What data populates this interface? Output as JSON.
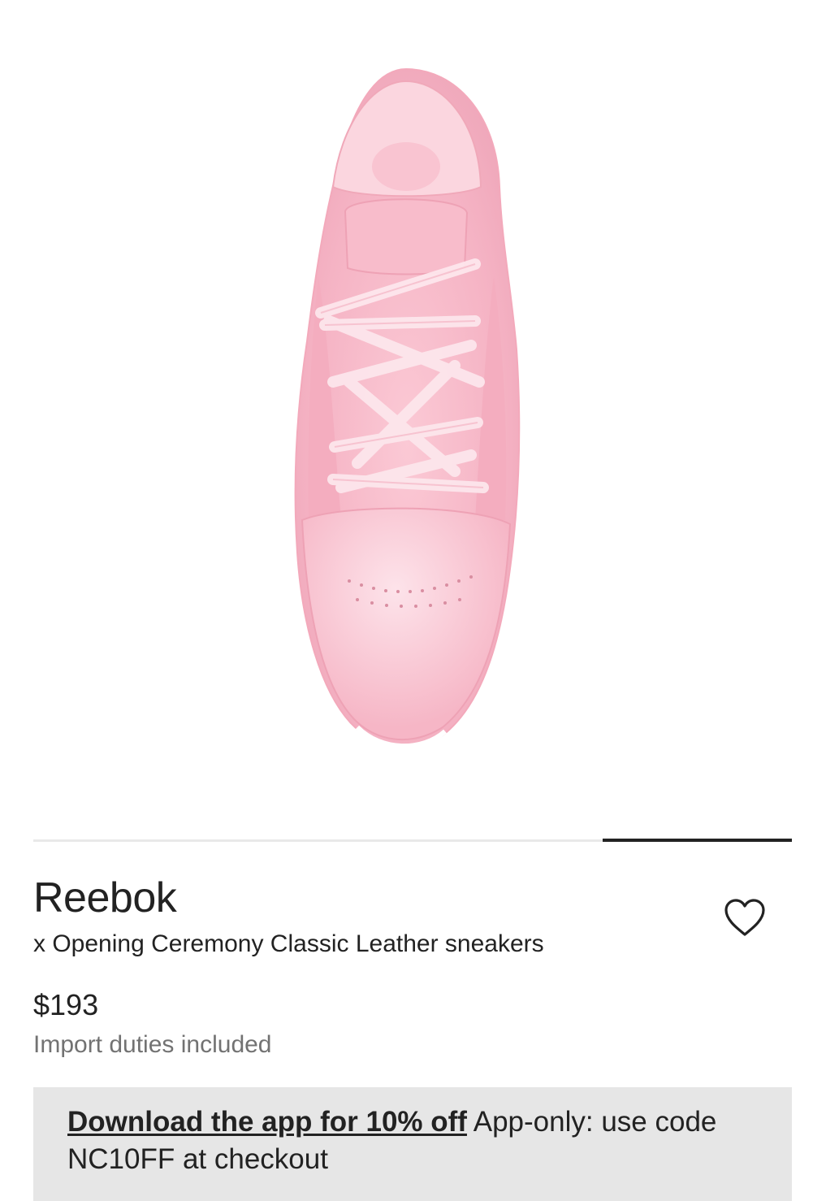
{
  "product": {
    "brand": "Reebok",
    "name": "x Opening Ceremony Classic Leather sneakers",
    "price": "$193",
    "duties_note": "Import duties included",
    "image_icon": "pink-sneaker-image"
  },
  "gallery": {
    "progress_fraction": 0.25,
    "progress_position": "last"
  },
  "wishlist": {
    "icon": "heart-outline-icon"
  },
  "promo": {
    "link_text": "Download the app for 10% off",
    "body_text": " App-only: use code NC10FF at checkout"
  },
  "colors": {
    "text": "#222222",
    "muted": "#727272",
    "promo_bg": "#e6e6e6",
    "shoe_pink": "#f7b9c8"
  }
}
